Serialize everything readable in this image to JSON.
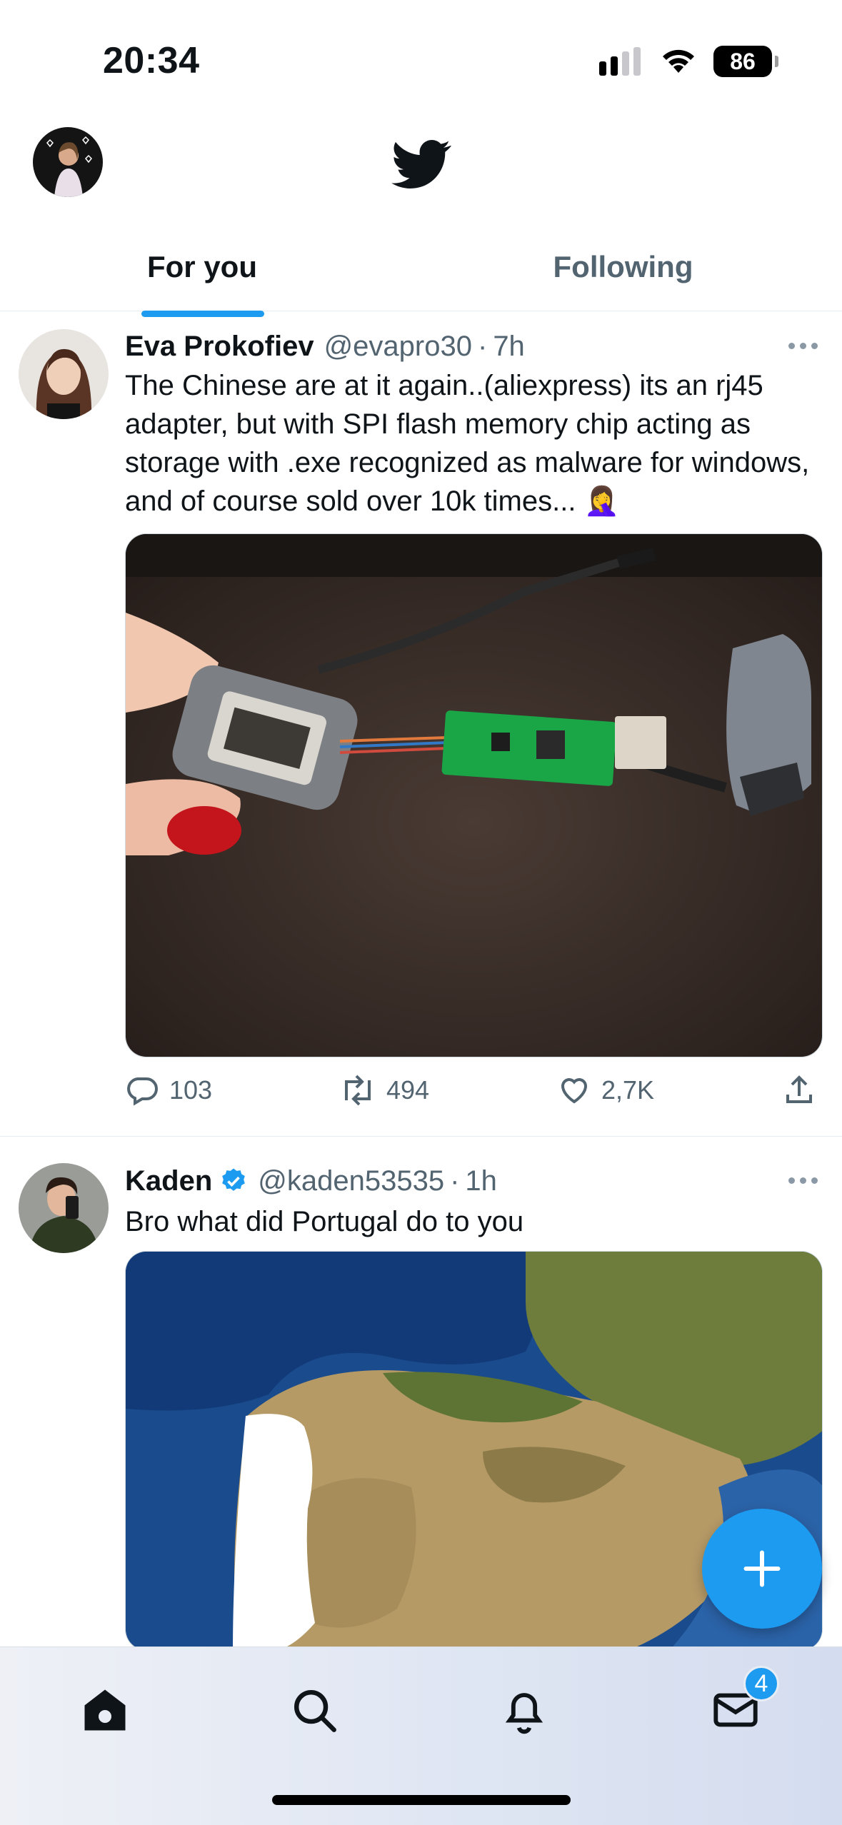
{
  "status_bar": {
    "time": "20:34",
    "battery": "86",
    "icons": [
      "cellular-signal-icon",
      "wifi-icon",
      "battery-icon"
    ]
  },
  "header": {
    "avatar": "profile-avatar",
    "logo": "twitter-bird-icon",
    "tabs": [
      {
        "label": "For you",
        "active": true
      },
      {
        "label": "Following",
        "active": false
      }
    ]
  },
  "tweets": [
    {
      "author": "Eva Prokofiev",
      "handle": "@evapro30",
      "separator": "·",
      "time": "7h",
      "text": "The Chinese are at it again..(aliexpress) its an rj45 adapter, but with SPI flash memory chip acting as storage with .exe recognized as malware for windows, and of course sold over 10k times... 🤦‍♀️",
      "media": "photo of rj45 adapter with green circuit board",
      "replies": "103",
      "retweets": "494",
      "likes": "2,7K"
    },
    {
      "author": "Kaden",
      "verified": true,
      "handle": "@kaden53535",
      "separator": "·",
      "time": "1h",
      "text": "Bro what did Portugal do to you",
      "media": "satellite map of Iberian peninsula"
    }
  ],
  "fab": {
    "icon": "compose-plus-icon"
  },
  "bottom_nav": {
    "items": [
      "home-icon",
      "search-icon",
      "notifications-bell-icon",
      "messages-mail-icon"
    ],
    "messages_badge": "4"
  },
  "colors": {
    "accent": "#1d9bf0",
    "text_primary": "#0f1419",
    "text_secondary": "#536471"
  }
}
